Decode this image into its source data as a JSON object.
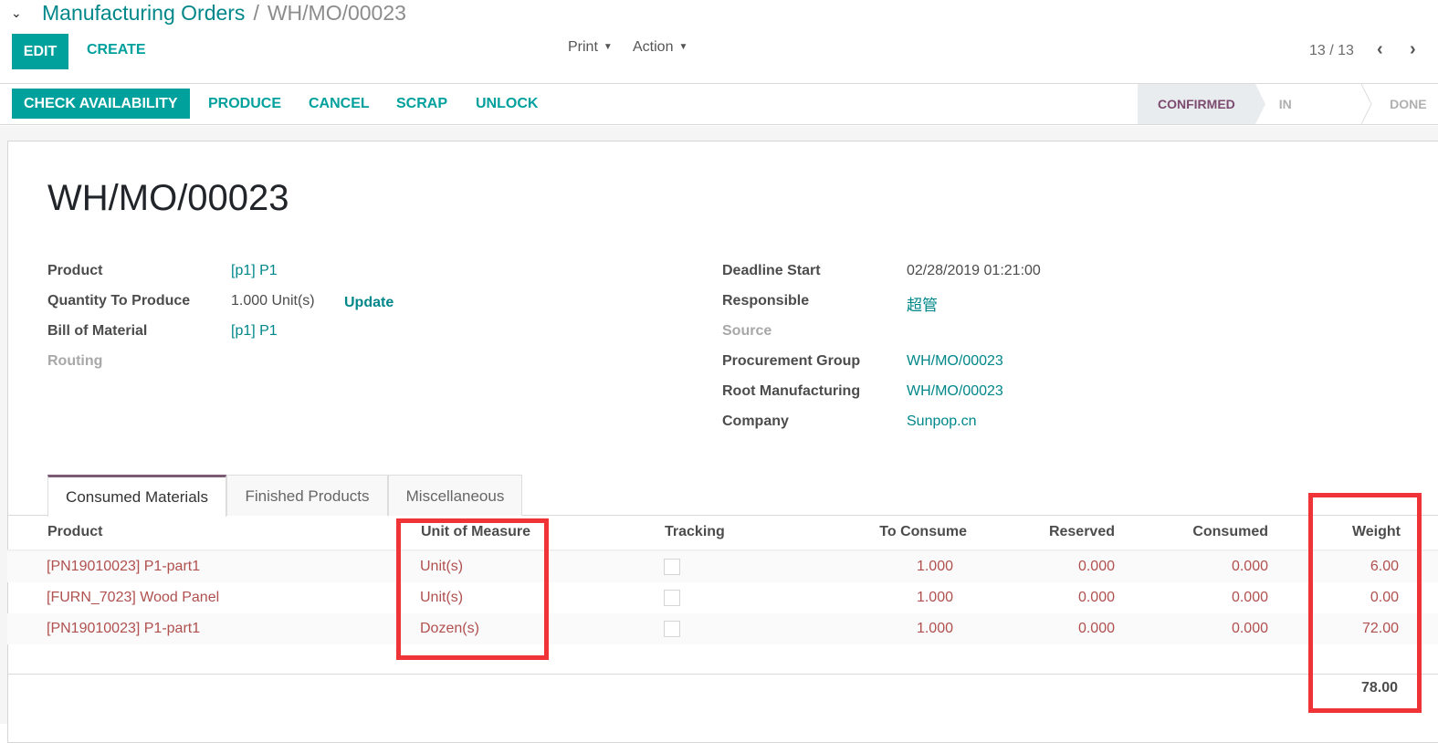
{
  "breadcrumb": {
    "parent": "Manufacturing Orders",
    "separator": "/",
    "current": "WH/MO/00023"
  },
  "toolbar": {
    "edit_label": "EDIT",
    "create_label": "CREATE",
    "print_label": "Print",
    "action_label": "Action",
    "pager": "13 / 13",
    "prev_icon": "‹",
    "next_icon": "›"
  },
  "header": {
    "buttons": [
      "CHECK AVAILABILITY",
      "PRODUCE",
      "CANCEL",
      "SCRAP",
      "UNLOCK"
    ],
    "stages": [
      "CONFIRMED",
      "IN PROGRESS",
      "DONE"
    ],
    "active_stage": "CONFIRMED"
  },
  "form": {
    "title": "WH/MO/00023",
    "left_fields": [
      {
        "label": "Product",
        "value": "[p1] P1"
      },
      {
        "label": "Quantity To Produce",
        "value": "1.000 Unit(s)",
        "action": "Update"
      },
      {
        "label": "Bill of Material",
        "value": "[p1] P1"
      },
      {
        "label": "Routing",
        "value": ""
      }
    ],
    "right_fields": [
      {
        "label": "Deadline Start",
        "value": "02/28/2019 01:21:00"
      },
      {
        "label": "Responsible",
        "value": "超管"
      },
      {
        "label": "Source",
        "value": ""
      },
      {
        "label": "Procurement Group",
        "value": "WH/MO/00023"
      },
      {
        "label": "Root Manufacturing",
        "value": "WH/MO/00023"
      },
      {
        "label": "Company",
        "value": "Sunpop.cn"
      }
    ]
  },
  "tabs": [
    "Consumed Materials",
    "Finished Products",
    "Miscellaneous"
  ],
  "active_tab": "Consumed Materials",
  "table": {
    "columns": [
      "Product",
      "Unit of Measure",
      "Tracking",
      "To Consume",
      "Reserved",
      "Consumed",
      "Weight"
    ],
    "rows": [
      {
        "product": "[PN19010023] P1-part1",
        "uom": "Unit(s)",
        "to_consume": "1.000",
        "reserved": "0.000",
        "consumed": "0.000",
        "weight": "6.00"
      },
      {
        "product": "[FURN_7023] Wood Panel",
        "uom": "Unit(s)",
        "to_consume": "1.000",
        "reserved": "0.000",
        "consumed": "0.000",
        "weight": "0.00"
      },
      {
        "product": "[PN19010023] P1-part1",
        "uom": "Dozen(s)",
        "to_consume": "1.000",
        "reserved": "0.000",
        "consumed": "0.000",
        "weight": "72.00"
      }
    ],
    "weight_total": "78.00"
  },
  "colors": {
    "primary": "#00a09d",
    "link": "#00878a",
    "stage_active": "#7c4a6f",
    "row_text": "#b0504f",
    "highlight": "#ef3336"
  }
}
